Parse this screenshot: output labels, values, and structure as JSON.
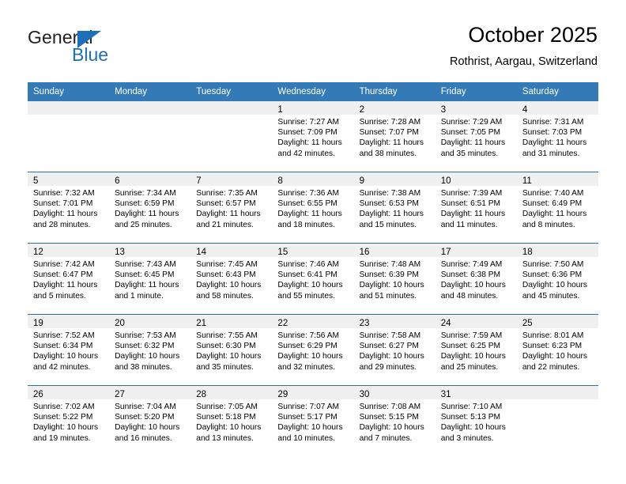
{
  "brand": {
    "name_top": "General",
    "name_bottom": "Blue",
    "flag_icon": "triangle-flag-icon",
    "color_blue": "#1c70b8",
    "color_dark": "#231f20"
  },
  "header": {
    "title": "October 2025",
    "subtitle": "Rothrist, Aargau, Switzerland"
  },
  "theme": {
    "header_blue": "#337ab7",
    "row_divider_blue": "#2f6fa7",
    "day_band_gray": "#f0f0f0",
    "text_black": "#000000"
  },
  "weekday_headers": [
    "Sunday",
    "Monday",
    "Tuesday",
    "Wednesday",
    "Thursday",
    "Friday",
    "Saturday"
  ],
  "weeks": [
    [
      {
        "day": "",
        "empty": true
      },
      {
        "day": "",
        "empty": true
      },
      {
        "day": "",
        "empty": true
      },
      {
        "day": "1",
        "sunrise": "Sunrise: 7:27 AM",
        "sunset": "Sunset: 7:09 PM",
        "daylight_1": "Daylight: 11 hours",
        "daylight_2": "and 42 minutes."
      },
      {
        "day": "2",
        "sunrise": "Sunrise: 7:28 AM",
        "sunset": "Sunset: 7:07 PM",
        "daylight_1": "Daylight: 11 hours",
        "daylight_2": "and 38 minutes."
      },
      {
        "day": "3",
        "sunrise": "Sunrise: 7:29 AM",
        "sunset": "Sunset: 7:05 PM",
        "daylight_1": "Daylight: 11 hours",
        "daylight_2": "and 35 minutes."
      },
      {
        "day": "4",
        "sunrise": "Sunrise: 7:31 AM",
        "sunset": "Sunset: 7:03 PM",
        "daylight_1": "Daylight: 11 hours",
        "daylight_2": "and 31 minutes."
      }
    ],
    [
      {
        "day": "5",
        "sunrise": "Sunrise: 7:32 AM",
        "sunset": "Sunset: 7:01 PM",
        "daylight_1": "Daylight: 11 hours",
        "daylight_2": "and 28 minutes."
      },
      {
        "day": "6",
        "sunrise": "Sunrise: 7:34 AM",
        "sunset": "Sunset: 6:59 PM",
        "daylight_1": "Daylight: 11 hours",
        "daylight_2": "and 25 minutes."
      },
      {
        "day": "7",
        "sunrise": "Sunrise: 7:35 AM",
        "sunset": "Sunset: 6:57 PM",
        "daylight_1": "Daylight: 11 hours",
        "daylight_2": "and 21 minutes."
      },
      {
        "day": "8",
        "sunrise": "Sunrise: 7:36 AM",
        "sunset": "Sunset: 6:55 PM",
        "daylight_1": "Daylight: 11 hours",
        "daylight_2": "and 18 minutes."
      },
      {
        "day": "9",
        "sunrise": "Sunrise: 7:38 AM",
        "sunset": "Sunset: 6:53 PM",
        "daylight_1": "Daylight: 11 hours",
        "daylight_2": "and 15 minutes."
      },
      {
        "day": "10",
        "sunrise": "Sunrise: 7:39 AM",
        "sunset": "Sunset: 6:51 PM",
        "daylight_1": "Daylight: 11 hours",
        "daylight_2": "and 11 minutes."
      },
      {
        "day": "11",
        "sunrise": "Sunrise: 7:40 AM",
        "sunset": "Sunset: 6:49 PM",
        "daylight_1": "Daylight: 11 hours",
        "daylight_2": "and 8 minutes."
      }
    ],
    [
      {
        "day": "12",
        "sunrise": "Sunrise: 7:42 AM",
        "sunset": "Sunset: 6:47 PM",
        "daylight_1": "Daylight: 11 hours",
        "daylight_2": "and 5 minutes."
      },
      {
        "day": "13",
        "sunrise": "Sunrise: 7:43 AM",
        "sunset": "Sunset: 6:45 PM",
        "daylight_1": "Daylight: 11 hours",
        "daylight_2": "and 1 minute."
      },
      {
        "day": "14",
        "sunrise": "Sunrise: 7:45 AM",
        "sunset": "Sunset: 6:43 PM",
        "daylight_1": "Daylight: 10 hours",
        "daylight_2": "and 58 minutes."
      },
      {
        "day": "15",
        "sunrise": "Sunrise: 7:46 AM",
        "sunset": "Sunset: 6:41 PM",
        "daylight_1": "Daylight: 10 hours",
        "daylight_2": "and 55 minutes."
      },
      {
        "day": "16",
        "sunrise": "Sunrise: 7:48 AM",
        "sunset": "Sunset: 6:39 PM",
        "daylight_1": "Daylight: 10 hours",
        "daylight_2": "and 51 minutes."
      },
      {
        "day": "17",
        "sunrise": "Sunrise: 7:49 AM",
        "sunset": "Sunset: 6:38 PM",
        "daylight_1": "Daylight: 10 hours",
        "daylight_2": "and 48 minutes."
      },
      {
        "day": "18",
        "sunrise": "Sunrise: 7:50 AM",
        "sunset": "Sunset: 6:36 PM",
        "daylight_1": "Daylight: 10 hours",
        "daylight_2": "and 45 minutes."
      }
    ],
    [
      {
        "day": "19",
        "sunrise": "Sunrise: 7:52 AM",
        "sunset": "Sunset: 6:34 PM",
        "daylight_1": "Daylight: 10 hours",
        "daylight_2": "and 42 minutes."
      },
      {
        "day": "20",
        "sunrise": "Sunrise: 7:53 AM",
        "sunset": "Sunset: 6:32 PM",
        "daylight_1": "Daylight: 10 hours",
        "daylight_2": "and 38 minutes."
      },
      {
        "day": "21",
        "sunrise": "Sunrise: 7:55 AM",
        "sunset": "Sunset: 6:30 PM",
        "daylight_1": "Daylight: 10 hours",
        "daylight_2": "and 35 minutes."
      },
      {
        "day": "22",
        "sunrise": "Sunrise: 7:56 AM",
        "sunset": "Sunset: 6:29 PM",
        "daylight_1": "Daylight: 10 hours",
        "daylight_2": "and 32 minutes."
      },
      {
        "day": "23",
        "sunrise": "Sunrise: 7:58 AM",
        "sunset": "Sunset: 6:27 PM",
        "daylight_1": "Daylight: 10 hours",
        "daylight_2": "and 29 minutes."
      },
      {
        "day": "24",
        "sunrise": "Sunrise: 7:59 AM",
        "sunset": "Sunset: 6:25 PM",
        "daylight_1": "Daylight: 10 hours",
        "daylight_2": "and 25 minutes."
      },
      {
        "day": "25",
        "sunrise": "Sunrise: 8:01 AM",
        "sunset": "Sunset: 6:23 PM",
        "daylight_1": "Daylight: 10 hours",
        "daylight_2": "and 22 minutes."
      }
    ],
    [
      {
        "day": "26",
        "sunrise": "Sunrise: 7:02 AM",
        "sunset": "Sunset: 5:22 PM",
        "daylight_1": "Daylight: 10 hours",
        "daylight_2": "and 19 minutes."
      },
      {
        "day": "27",
        "sunrise": "Sunrise: 7:04 AM",
        "sunset": "Sunset: 5:20 PM",
        "daylight_1": "Daylight: 10 hours",
        "daylight_2": "and 16 minutes."
      },
      {
        "day": "28",
        "sunrise": "Sunrise: 7:05 AM",
        "sunset": "Sunset: 5:18 PM",
        "daylight_1": "Daylight: 10 hours",
        "daylight_2": "and 13 minutes."
      },
      {
        "day": "29",
        "sunrise": "Sunrise: 7:07 AM",
        "sunset": "Sunset: 5:17 PM",
        "daylight_1": "Daylight: 10 hours",
        "daylight_2": "and 10 minutes."
      },
      {
        "day": "30",
        "sunrise": "Sunrise: 7:08 AM",
        "sunset": "Sunset: 5:15 PM",
        "daylight_1": "Daylight: 10 hours",
        "daylight_2": "and 7 minutes."
      },
      {
        "day": "31",
        "sunrise": "Sunrise: 7:10 AM",
        "sunset": "Sunset: 5:13 PM",
        "daylight_1": "Daylight: 10 hours",
        "daylight_2": "and 3 minutes."
      },
      {
        "day": "",
        "empty": true
      }
    ]
  ]
}
